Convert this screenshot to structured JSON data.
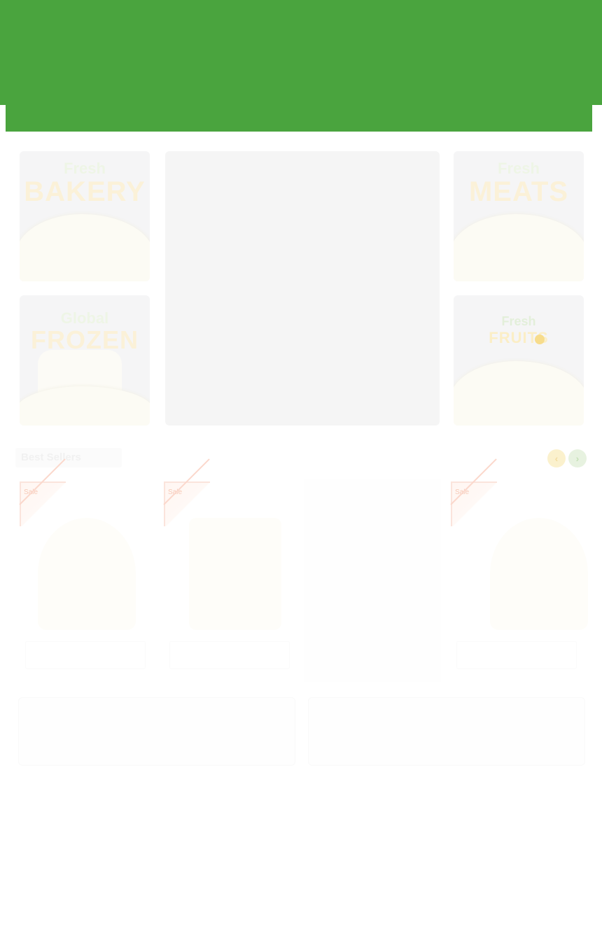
{
  "colors": {
    "header_green": "#4aa43e",
    "tile_bg": "#f5f5f6",
    "hero_bg": "#f5f5f5",
    "prev_button": "#fbf1cd",
    "next_button": "#e7f2e0"
  },
  "categories": [
    {
      "small": "Fresh",
      "big": "BAKERY"
    },
    {
      "small": "Fresh",
      "big": "MEATS"
    },
    {
      "small": "Global",
      "big": "FROZEN"
    },
    {
      "small": "Fresh",
      "big": "FRUITS"
    }
  ],
  "section": {
    "title": "Best Sellers"
  },
  "carousel": {
    "prev_icon": "‹",
    "next_icon": "›"
  },
  "products": [
    {
      "badge": "Sale",
      "name": "",
      "price": ""
    },
    {
      "badge": "Sale",
      "name": "",
      "price": ""
    },
    {
      "badge": "Sale",
      "name": "",
      "price": ""
    }
  ]
}
